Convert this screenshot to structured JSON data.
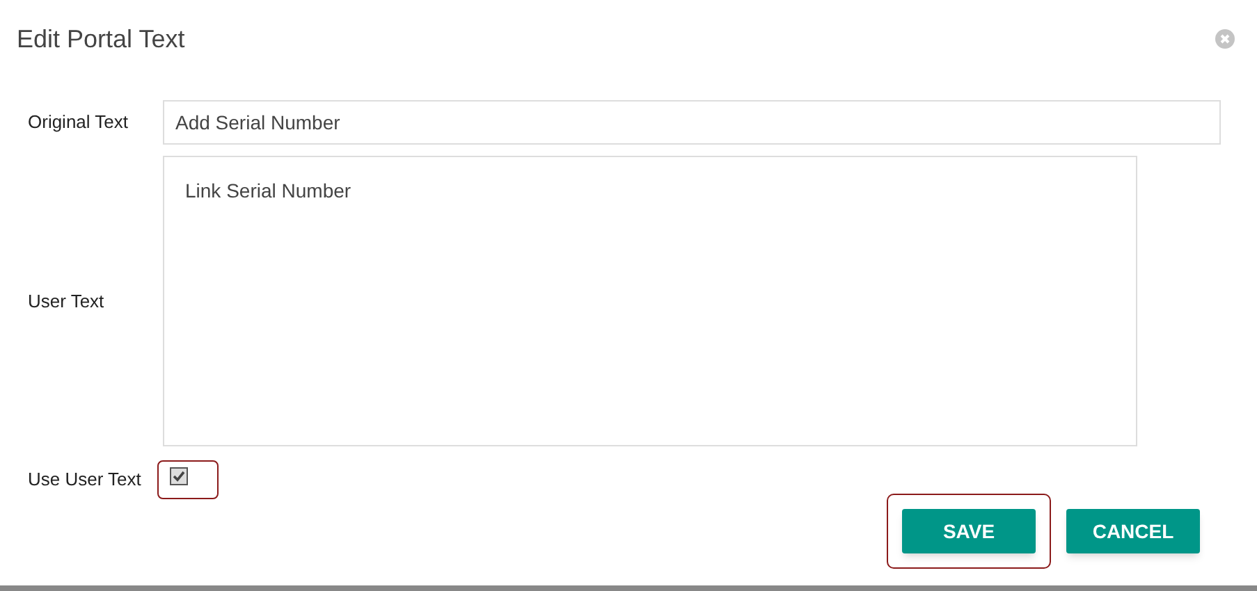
{
  "dialog": {
    "title": "Edit Portal Text"
  },
  "fields": [
    {
      "kind": "input",
      "label": "Original Text",
      "value": "Add Serial Number"
    },
    {
      "kind": "textarea",
      "label": "User Text",
      "value": "Link Serial Number"
    }
  ],
  "use_user_text": {
    "label": "Use User Text",
    "checked": true,
    "highlighted": true
  },
  "buttons": [
    {
      "label": "SAVE",
      "highlighted": true
    },
    {
      "label": "CANCEL",
      "highlighted": false
    }
  ]
}
